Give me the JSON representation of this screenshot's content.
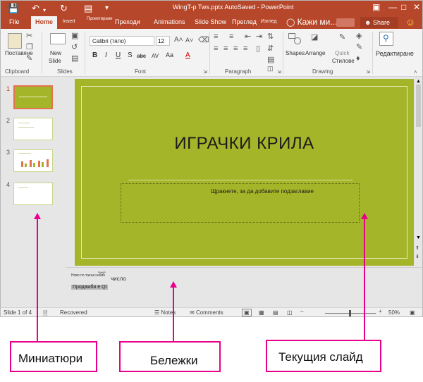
{
  "titlebar": {
    "title": "WingT-p Tws.pptx AutoSaved - PowerPoint",
    "save_icon": "save-icon",
    "undo_icon": "undo-icon",
    "redo_icon": "redo-icon",
    "present_icon": "present-icon"
  },
  "tabs": {
    "file": "File",
    "home": "Home",
    "insert": "Insert",
    "design": "Проектиране",
    "transitions": "Преходи",
    "animations": "Animations",
    "slideshow": "Slide Show",
    "review": "Преглед",
    "view": "Изглед",
    "tellme": "Кажи ми...",
    "share": "Share"
  },
  "ribbon": {
    "paste": "Поставяне",
    "new_slide": "New",
    "new_slide2": "Slide",
    "font_name": "Calibri (тяло)",
    "font_size": "12",
    "shapes": "Shapes",
    "arrange": "Arrange",
    "quick_styles": "Quick",
    "quick_styles2": "Стилове",
    "editing": "Редактиране",
    "groups": {
      "clipboard": "Clipboard",
      "slides": "Slides",
      "font": "Font",
      "paragraph": "Paragraph",
      "drawing": "Drawing"
    }
  },
  "thumbnails": [
    {
      "number": "1",
      "active": true
    },
    {
      "number": "2",
      "active": false
    },
    {
      "number": "3",
      "active": false
    },
    {
      "number": "4",
      "active": false
    }
  ],
  "slide": {
    "title": "ИГРАЧКИ КРИЛА",
    "subtitle_placeholder": "Щракнете, за да добавите подзаглавие",
    "background": "#a5b52a"
  },
  "notes": {
    "line1": "Ново по такъв начин",
    "word": "число",
    "line2": "Продажби е Ql"
  },
  "status": {
    "slide_of": "Slide 1 of 4",
    "recovered": "Recovered",
    "notes": "Notes",
    "comments": "Comments",
    "zoom": "50%"
  },
  "callouts": {
    "thumbnails": "Миниатюри",
    "notes": "Бележки",
    "current_slide": "Текущия слайд"
  },
  "colors": {
    "accent": "#b7472a",
    "callout": "#e8008d",
    "slide_bg": "#a5b52a"
  }
}
